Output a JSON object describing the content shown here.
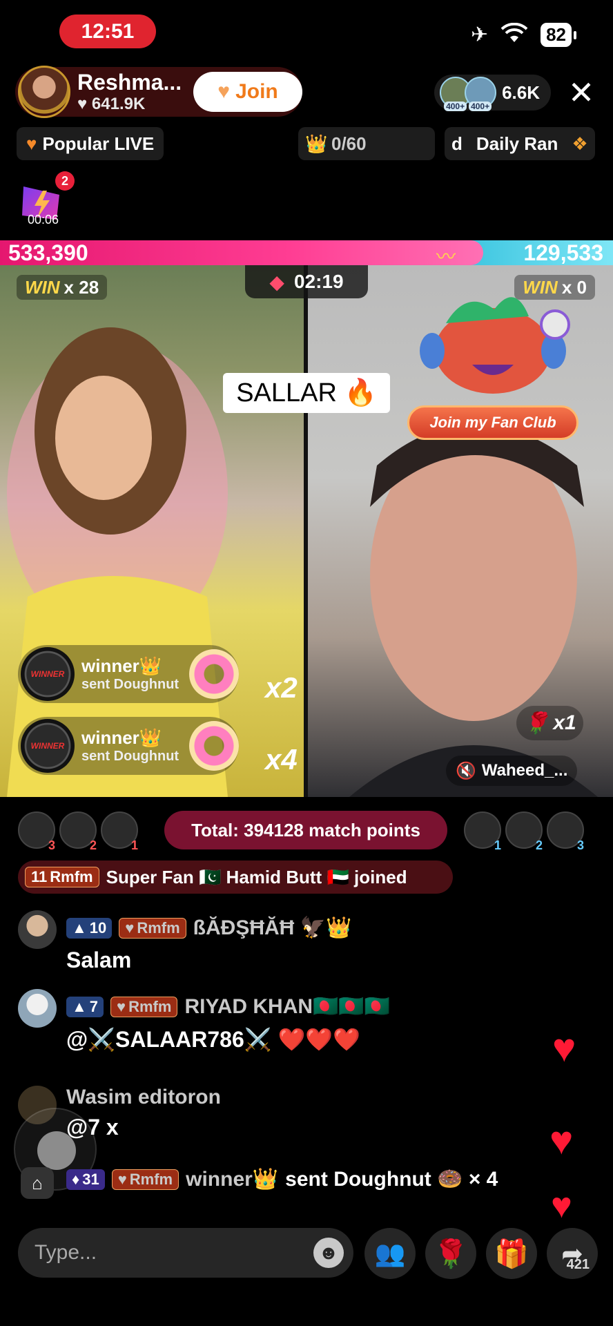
{
  "status_bar": {
    "time": "12:51",
    "battery": "82"
  },
  "host": {
    "name": "Reshma...",
    "likes": "♥ 641.9K",
    "join_label": "Join"
  },
  "viewers": {
    "badge1": "400+",
    "badge2": "400+",
    "count": "6.6K"
  },
  "top_row": {
    "popular": "Popular LIVE",
    "rank": "0/60",
    "daily_prefix": "d",
    "daily": "Daily Ran"
  },
  "boost": {
    "badge": "2",
    "time": "00:06"
  },
  "battle": {
    "left_score": "533,390",
    "right_score": "129,533",
    "timer": "02:19",
    "left_win_label": "WIN",
    "left_win_count": "x 28",
    "right_win_label": "WIN",
    "right_win_count": "x 0",
    "center_label": "SALLAR 🔥",
    "fan_club": "Join my Fan Club",
    "right_name": "Waheed_...",
    "rose_mult": "x1"
  },
  "gifts": [
    {
      "avatar_text": "WINNER",
      "name": "winner👑",
      "action": "sent Doughnut",
      "mult": "x2"
    },
    {
      "avatar_text": "WINNER",
      "name": "winner👑",
      "action": "sent Doughnut",
      "mult": "x4"
    }
  ],
  "match": {
    "total": "Total: 394128 match points",
    "left_ranks": [
      "3",
      "2",
      "1"
    ],
    "right_ranks": [
      "1",
      "2",
      "3"
    ]
  },
  "superfan": {
    "tag_level": "11",
    "tag_name": "Rmfm",
    "text": "Super Fan 🇵🇰 Hamid Butt 🇦🇪 joined"
  },
  "chat": [
    {
      "level": "10",
      "fan_tag": "Rmfm",
      "name": "ßĂĐŞĦĂĦ 🦅👑",
      "message": "Salam"
    },
    {
      "level": "7",
      "fan_tag": "Rmfm",
      "name": "RIYAD KHAN🇧🇩🇧🇩🇧🇩",
      "message": "@⚔️SALAAR786⚔️ ❤️❤️❤️"
    },
    {
      "level": "",
      "fan_tag": "",
      "name": "Wasim editoron",
      "message": "@7 x"
    },
    {
      "level": "31",
      "fan_tag": "Rmfm",
      "name": "winner👑",
      "message": "sent Doughnut 🍩 × 4"
    }
  ],
  "bottom": {
    "placeholder": "Type...",
    "share_count": "421"
  },
  "colors": {
    "accent_pink": "#e5176f",
    "accent_blue": "#3fc6e0",
    "join_orange": "#f07a1a"
  }
}
